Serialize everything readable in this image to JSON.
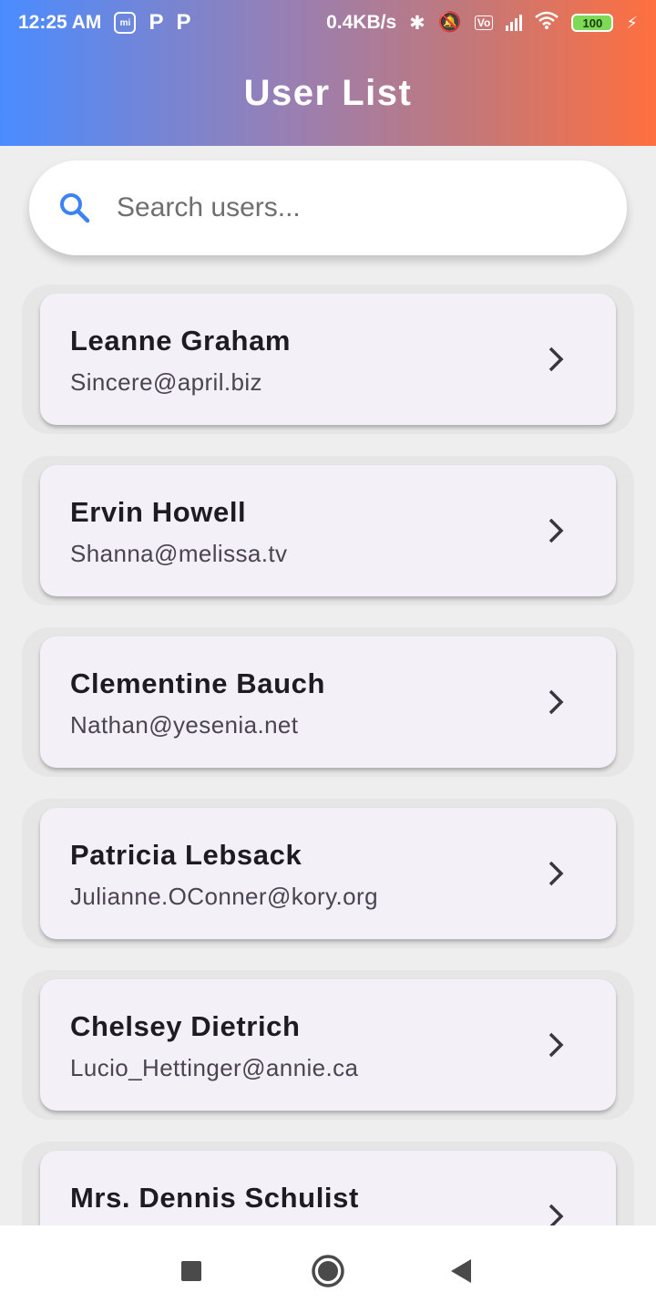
{
  "status_bar": {
    "time": "12:25 AM",
    "left_icons": [
      "mi-icon",
      "p-icon",
      "p-icon"
    ],
    "net_speed": "0.4KB/s",
    "right_icons": [
      "bluetooth-icon",
      "mute-icon",
      "volte-icon",
      "signal-icon",
      "wifi-icon"
    ],
    "battery": "100"
  },
  "header": {
    "title": "User List",
    "gradient": [
      "#4a8cff",
      "#ff6f3f"
    ]
  },
  "search": {
    "placeholder": "Search users...",
    "icon": "search-icon",
    "icon_color": "#3b82f6"
  },
  "users": [
    {
      "name": "Leanne Graham",
      "email": "Sincere@april.biz"
    },
    {
      "name": "Ervin Howell",
      "email": "Shanna@melissa.tv"
    },
    {
      "name": "Clementine Bauch",
      "email": "Nathan@yesenia.net"
    },
    {
      "name": "Patricia Lebsack",
      "email": "Julianne.OConner@kory.org"
    },
    {
      "name": "Chelsey Dietrich",
      "email": "Lucio_Hettinger@annie.ca"
    },
    {
      "name": "Mrs. Dennis Schulist",
      "email": ""
    }
  ],
  "nav": {
    "buttons": [
      "recents-square-icon",
      "home-circle-icon",
      "back-triangle-icon"
    ]
  }
}
